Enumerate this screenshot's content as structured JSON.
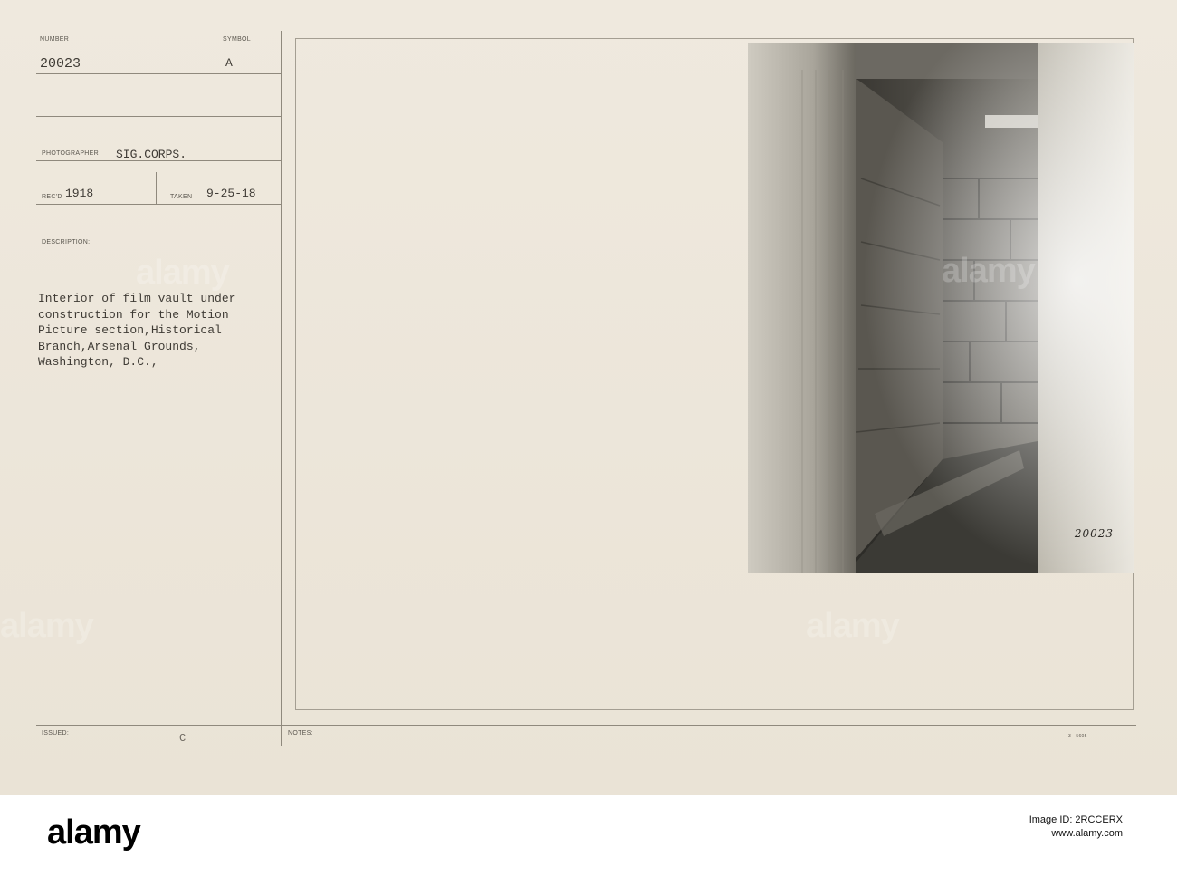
{
  "card": {
    "number_label": "NUMBER",
    "number_value": "20023",
    "symbol_label": "SYMBOL",
    "symbol_value": "A",
    "photographer_label": "PHOTOGRAPHER",
    "photographer_value": "SIG.CORPS.",
    "recd_label": "REC'D",
    "recd_value": "1918",
    "taken_label": "TAKEN",
    "taken_value": "9-25-18",
    "description_label": "DESCRIPTION:",
    "description_lines": [
      "Interior of film vault under",
      "construction for the Motion",
      "Picture section,Historical",
      "Branch,Arsenal Grounds,",
      "Washington, D.C.,"
    ],
    "issued_label": "ISSUED:",
    "issued_mark": "C",
    "notes_label": "NOTES:",
    "form_code": "3—5605"
  },
  "photo": {
    "number_written": "20023"
  },
  "watermark": {
    "text": "alamy"
  },
  "footer": {
    "brand": "alamy",
    "image_id_line1": "Image ID: 2RCCERX",
    "image_id_line2": "www.alamy.com"
  }
}
